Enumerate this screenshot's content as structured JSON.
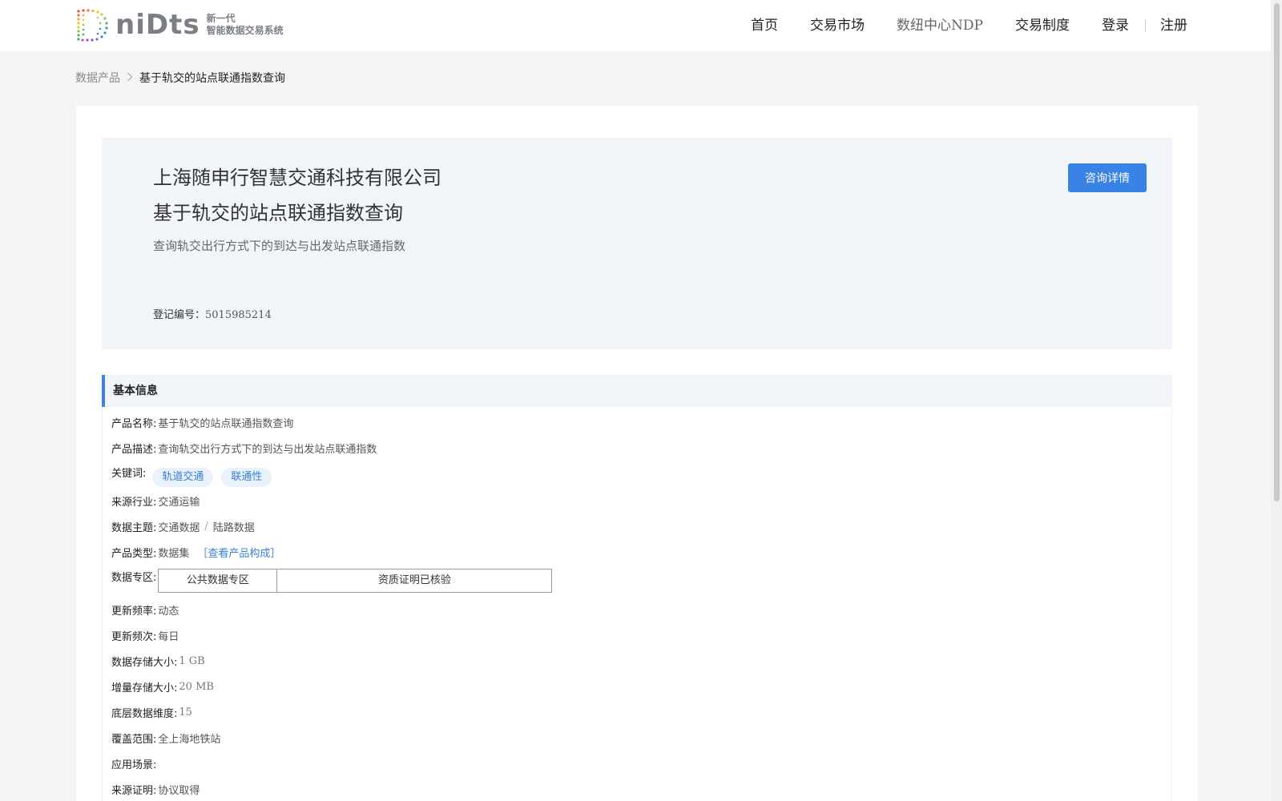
{
  "header": {
    "logo_word": "niDts",
    "logo_sub1": "新一代",
    "logo_sub2": "智能数据交易系统",
    "nav": [
      {
        "label": "首页"
      },
      {
        "label": "交易市场"
      },
      {
        "label": "数纽中心NDP"
      },
      {
        "label": "交易制度"
      },
      {
        "label": "登录"
      },
      {
        "label": "注册"
      }
    ]
  },
  "breadcrumb": {
    "parent": "数据产品",
    "current": "基于轨交的站点联通指数查询"
  },
  "hero": {
    "company": "上海随申行智慧交通科技有限公司",
    "title": "基于轨交的站点联通指数查询",
    "description": "查询轨交出行方式下的到达与出发站点联通指数",
    "reg_label": "登记编号：",
    "reg_value": "5015985214",
    "consult_button": "咨询详情"
  },
  "basic_info": {
    "section_title": "基本信息",
    "product_name_label": "产品名称:",
    "product_name": "基于轨交的站点联通指数查询",
    "product_desc_label": "产品描述:",
    "product_desc": "查询轨交出行方式下的到达与出发站点联通指数",
    "keywords_label": "关键词:",
    "keywords": [
      "轨道交通",
      "联通性"
    ],
    "industry_label": "来源行业:",
    "industry": "交通运输",
    "theme_label": "数据主题:",
    "theme_primary": "交通数据",
    "theme_sep": "/",
    "theme_secondary": "陆路数据",
    "type_label": "产品类型:",
    "type": "数据集",
    "type_link": "［查看产品构成］",
    "zone_label": "数据专区:",
    "zone_cells": [
      "公共数据专区",
      "资质证明已核验"
    ],
    "freq_label": "更新频率:",
    "freq": "动态",
    "cycle_label": "更新频次:",
    "cycle": "每日",
    "storage_label": "数据存储大小:",
    "storage": "1 GB",
    "increment_label": "增量存储大小:",
    "increment": "20 MB",
    "dimension_label": "底层数据维度:",
    "dimension": "15",
    "coverage_label": "覆盖范围:",
    "coverage": "全上海地铁站",
    "scenario_label": "应用场景:",
    "scenario": "",
    "source_label": "来源证明:",
    "source": "协议取得"
  }
}
